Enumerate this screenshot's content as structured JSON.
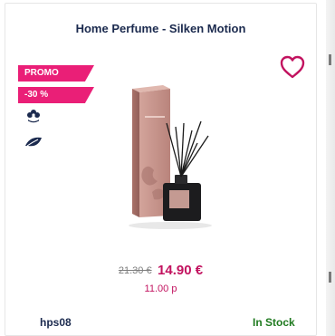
{
  "product": {
    "title": "Home Perfume - Silken Motion",
    "badges": {
      "promo": "PROMO",
      "discount": "-30 %"
    },
    "price": {
      "old": "21.30 €",
      "new": "14.90 €",
      "points": "11.00 p"
    },
    "sku": "hps08",
    "stock_status": "In Stock"
  },
  "icons": {
    "wishlist": "heart-outline-icon",
    "feature_1": "flower-icon",
    "feature_2": "leaf-icon"
  },
  "colors": {
    "accent_pink": "#ea1f77",
    "price_pink": "#c2125f",
    "navy": "#1b2a4e",
    "in_stock_green": "#1f7a1f"
  }
}
